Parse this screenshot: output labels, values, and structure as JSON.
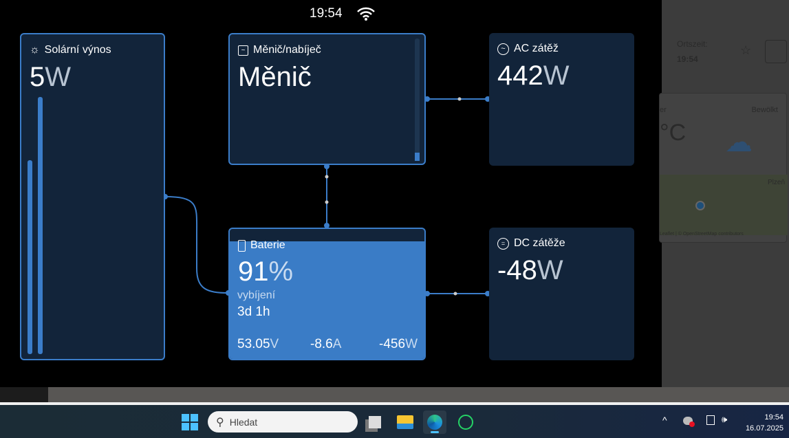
{
  "status": {
    "time": "19:54"
  },
  "solar": {
    "title": "Solární výnos",
    "value": "5",
    "unit": "W"
  },
  "inverter": {
    "title": "Měnič/nabíječ",
    "state": "Měnič"
  },
  "ac": {
    "title": "AC zátěž",
    "value": "442",
    "unit": "W"
  },
  "battery": {
    "title": "Baterie",
    "soc": "91",
    "soc_unit": "%",
    "soc_fraction": 0.91,
    "state": "vybíjení",
    "time_left": "3d 1h",
    "voltage": "53.05",
    "voltage_unit": "V",
    "current": "-8.6",
    "current_unit": "A",
    "power": "-456",
    "power_unit": "W"
  },
  "dc": {
    "title": "DC zátěže",
    "value": "-48",
    "unit": "W"
  },
  "background_page": {
    "local_time_label": "Ortszeit:",
    "local_time": "19:54",
    "weather_partial_label": "er",
    "temp_partial": "°C",
    "weather": "Bewölkt",
    "map_city": "Plzeň",
    "map_attribution": "Leaflet | © OpenStreetMap contributors"
  },
  "taskbar": {
    "search_placeholder": "Hledat",
    "time": "19:54",
    "date": "16.07.2025"
  }
}
